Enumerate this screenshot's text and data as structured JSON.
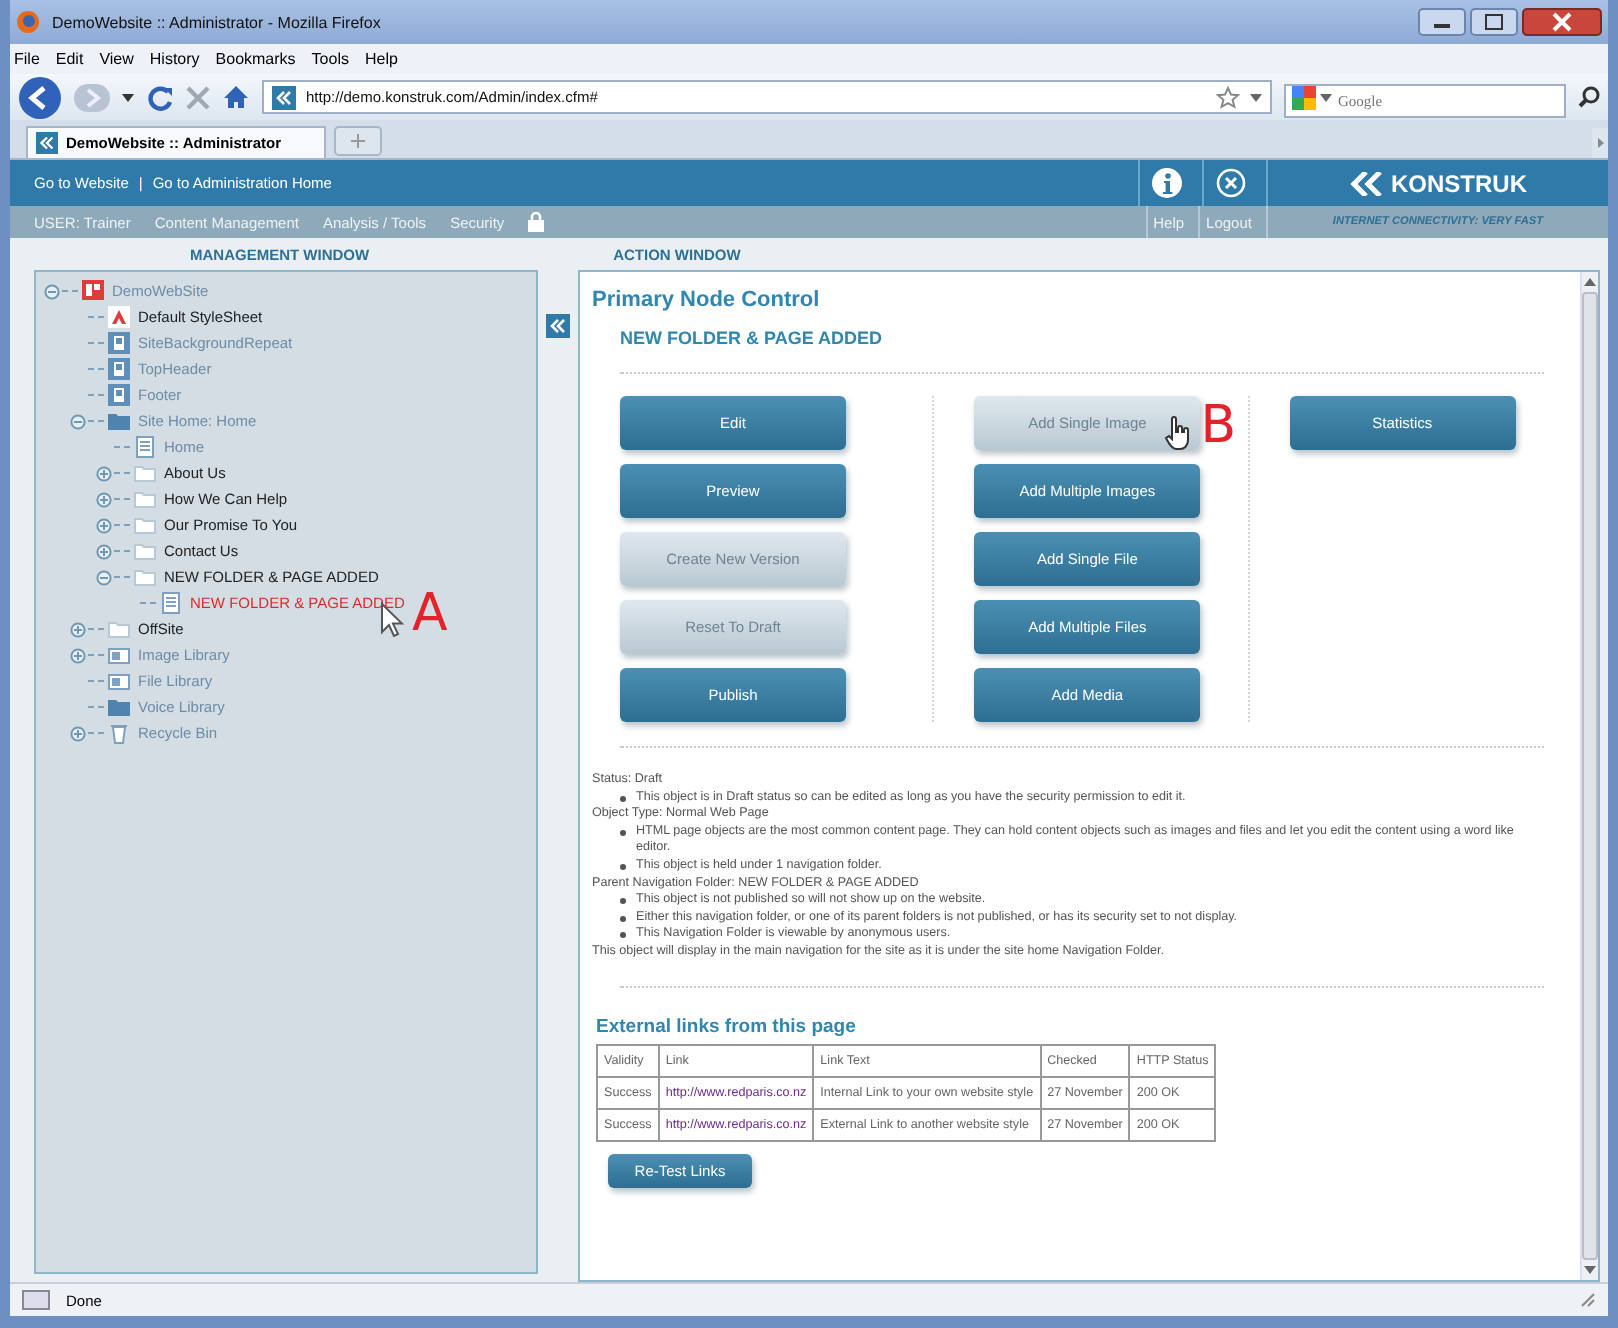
{
  "window": {
    "title": "DemoWebsite :: Administrator - Mozilla Firefox"
  },
  "menu": [
    "File",
    "Edit",
    "View",
    "History",
    "Bookmarks",
    "Tools",
    "Help"
  ],
  "address": {
    "url": "http://demo.konstruk.com/Admin/index.cfm#",
    "search_placeholder": "Google"
  },
  "tabs": [
    {
      "label": "DemoWebsite :: Administrator",
      "selected": true
    }
  ],
  "app_header": {
    "top_links": [
      "Go to Website",
      "Go to Administration Home"
    ],
    "separator": "|",
    "user": "USER: Trainer",
    "nav": [
      "Content Management",
      "Analysis / Tools",
      "Security"
    ],
    "help": "Help",
    "logout": "Logout",
    "logo": "KONSTRUK",
    "tagline": "INTERNET CONNECTIVITY: VERY FAST"
  },
  "panel_labels": {
    "left": "MANAGEMENT WINDOW",
    "right": "ACTION WINDOW"
  },
  "tree": [
    {
      "label": "DemoWebSite",
      "kind": "root",
      "expanded": true,
      "dimmed": true,
      "selected": false,
      "children": [
        {
          "label": "Default StyleSheet",
          "kind": "stylesheet",
          "dimmed": false,
          "selected": false
        },
        {
          "label": "SiteBackgroundRepeat",
          "kind": "image",
          "dimmed": true,
          "selected": false
        },
        {
          "label": "TopHeader",
          "kind": "image",
          "dimmed": true,
          "selected": false
        },
        {
          "label": "Footer",
          "kind": "image",
          "dimmed": true,
          "selected": false
        },
        {
          "label": "Site Home: Home",
          "kind": "site-folder",
          "expanded": true,
          "dimmed": true,
          "selected": false,
          "children": [
            {
              "label": "Home",
              "kind": "page",
              "dimmed": true,
              "selected": false
            },
            {
              "label": "About Us",
              "kind": "nav-folder",
              "expanded": false,
              "dimmed": false,
              "selected": false
            },
            {
              "label": "How We Can Help",
              "kind": "nav-folder",
              "expanded": false,
              "dimmed": false,
              "selected": false
            },
            {
              "label": "Our Promise To You",
              "kind": "nav-folder",
              "expanded": false,
              "dimmed": false,
              "selected": false
            },
            {
              "label": "Contact Us",
              "kind": "nav-folder",
              "expanded": false,
              "dimmed": false,
              "selected": false
            },
            {
              "label": "NEW FOLDER & PAGE ADDED",
              "kind": "nav-folder",
              "expanded": true,
              "dimmed": false,
              "selected": false,
              "children": [
                {
                  "label": "NEW FOLDER & PAGE ADDED",
                  "kind": "page",
                  "dimmed": false,
                  "selected": true
                }
              ]
            }
          ]
        },
        {
          "label": "OffSite",
          "kind": "nav-folder",
          "expanded": false,
          "dimmed": false,
          "selected": false
        },
        {
          "label": "Image Library",
          "kind": "library",
          "expanded": false,
          "dimmed": true,
          "selected": false
        },
        {
          "label": "File Library",
          "kind": "library",
          "dimmed": true,
          "selected": false
        },
        {
          "label": "Voice Library",
          "kind": "site-folder",
          "dimmed": true,
          "selected": false
        },
        {
          "label": "Recycle Bin",
          "kind": "bin",
          "expanded": false,
          "dimmed": true,
          "selected": false
        }
      ]
    }
  ],
  "annotations": [
    {
      "label": "A"
    },
    {
      "label": "B"
    }
  ],
  "action": {
    "title": "Primary Node Control",
    "subtitle": "NEW FOLDER & PAGE ADDED",
    "button_columns": [
      [
        {
          "label": "Edit",
          "disabled": false
        },
        {
          "label": "Preview",
          "disabled": false
        },
        {
          "label": "Create New Version",
          "disabled": true
        },
        {
          "label": "Reset To Draft",
          "disabled": true
        },
        {
          "label": "Publish",
          "disabled": false
        }
      ],
      [
        {
          "label": "Add Single Image",
          "disabled": true
        },
        {
          "label": "Add Multiple Images",
          "disabled": false
        },
        {
          "label": "Add Single File",
          "disabled": false
        },
        {
          "label": "Add Multiple Files",
          "disabled": false
        },
        {
          "label": "Add Media",
          "disabled": false
        }
      ],
      [
        {
          "label": "Statistics",
          "disabled": false
        }
      ]
    ],
    "details": [
      {
        "text": "Status: Draft",
        "bullets": [
          "This object is in Draft status so can be edited as long as you have the security permission to edit it."
        ]
      },
      {
        "text": "Object Type: Normal Web Page",
        "bullets": [
          "HTML page objects are the most common content page. They can hold content objects such as images and files and let you edit the content using a word like editor.",
          "This object is held under 1 navigation folder."
        ]
      },
      {
        "text": "Parent Navigation Folder: NEW FOLDER & PAGE ADDED",
        "bullets": [
          "This object is not published so will not show up on the website.",
          "Either this navigation folder, or one of its parent folders is not published, or has its security set to not display.",
          "This Navigation Folder is viewable by anonymous users."
        ]
      },
      {
        "text": "This object will display in the main navigation for the site as it is under the site home Navigation Folder."
      }
    ],
    "links_title": "External links from this page",
    "links_table": {
      "columns": [
        "Validity",
        "Link",
        "Link Text",
        "Checked",
        "HTTP Status"
      ],
      "rows": [
        [
          "Success",
          "http://www.redparis.co.nz",
          "Internal Link to your own website style",
          "27 November",
          "200 OK"
        ],
        [
          "Success",
          "http://www.redparis.co.nz",
          "External Link to another website style",
          "27 November",
          "200 OK"
        ]
      ]
    },
    "retest_button": "Re-Test Links"
  },
  "status_bar": "Done"
}
